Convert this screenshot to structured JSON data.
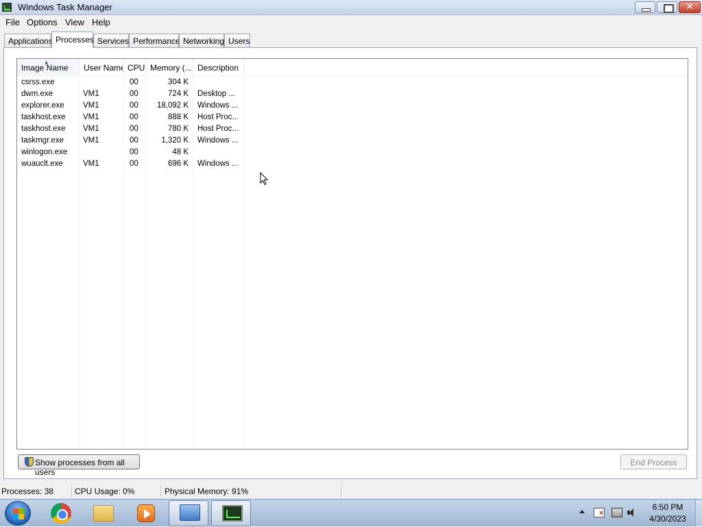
{
  "window": {
    "title": "Windows Task Manager"
  },
  "menu": [
    "File",
    "Options",
    "View",
    "Help"
  ],
  "tabs": [
    {
      "label": "Applications",
      "active": false
    },
    {
      "label": "Processes",
      "active": true
    },
    {
      "label": "Services",
      "active": false
    },
    {
      "label": "Performance",
      "active": false
    },
    {
      "label": "Networking",
      "active": false
    },
    {
      "label": "Users",
      "active": false
    }
  ],
  "process_table": {
    "columns": [
      "Image Name",
      "User Name",
      "CPU",
      "Memory (...",
      "Description"
    ],
    "sorted_column": "Image Name",
    "rows": [
      {
        "name": "csrss.exe",
        "user": "",
        "cpu": "00",
        "memory": "304 K",
        "description": ""
      },
      {
        "name": "dwm.exe",
        "user": "VM1",
        "cpu": "00",
        "memory": "724 K",
        "description": "Desktop ..."
      },
      {
        "name": "explorer.exe",
        "user": "VM1",
        "cpu": "00",
        "memory": "18,092 K",
        "description": "Windows ..."
      },
      {
        "name": "taskhost.exe",
        "user": "VM1",
        "cpu": "00",
        "memory": "888 K",
        "description": "Host Proc..."
      },
      {
        "name": "taskhost.exe",
        "user": "VM1",
        "cpu": "00",
        "memory": "780 K",
        "description": "Host Proc..."
      },
      {
        "name": "taskmgr.exe",
        "user": "VM1",
        "cpu": "00",
        "memory": "1,320 K",
        "description": "Windows ..."
      },
      {
        "name": "winlogon.exe",
        "user": "",
        "cpu": "00",
        "memory": "48 K",
        "description": ""
      },
      {
        "name": "wuauclt.exe",
        "user": "VM1",
        "cpu": "00",
        "memory": "696 K",
        "description": "Windows ..."
      }
    ]
  },
  "buttons": {
    "show_all_users": "Show processes from all users",
    "end_process": "End Process"
  },
  "status": {
    "processes": "Processes: 38",
    "cpu": "CPU Usage: 0%",
    "memory": "Physical Memory: 91%"
  },
  "taskbar": {
    "pinned": [
      "start-orb",
      "chrome-icon",
      "folder-icon",
      "media-player-icon",
      "remote-desktop-icon",
      "task-manager-icon"
    ],
    "tray_icons": [
      "show-hidden-icons",
      "action-center-flag-icon",
      "network-icon",
      "volume-icon"
    ],
    "clock_time": "6:50 PM",
    "clock_date": "4/30/2023"
  },
  "colors": {
    "title_bar": "#c4d5ea",
    "taskbar": "#9fb6d2",
    "close_button": "#c4402b"
  }
}
